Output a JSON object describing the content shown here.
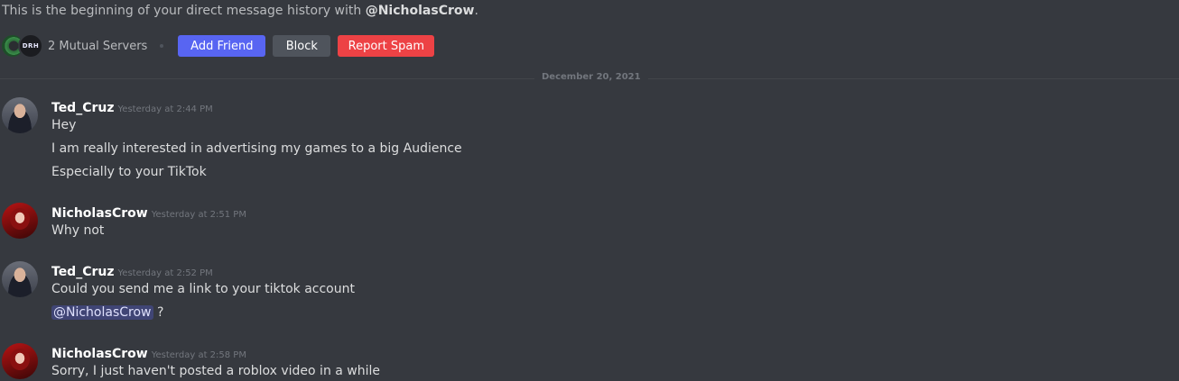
{
  "intro": {
    "prefix": "This is the beginning of your direct message history with ",
    "name": "@NicholasCrow",
    "suffix": "."
  },
  "mutual": {
    "server_icon_2_text": "DRH",
    "label": "2 Mutual Servers"
  },
  "buttons": {
    "add_friend": "Add Friend",
    "block": "Block",
    "report_spam": "Report Spam"
  },
  "divider": {
    "date": "December 20, 2021"
  },
  "messages": [
    {
      "author": "Ted_Cruz",
      "timestamp": "Yesterday at 2:44 PM",
      "lines": [
        "Hey",
        "I am really interested in advertising my games to a big Audience",
        "Especially to your TikTok"
      ]
    },
    {
      "author": "NicholasCrow",
      "timestamp": "Yesterday at 2:51 PM",
      "lines": [
        "Why not"
      ]
    },
    {
      "author": "Ted_Cruz",
      "timestamp": "Yesterday at 2:52 PM",
      "lines": [
        "Could you send me a link to your tiktok account"
      ],
      "mention_line": {
        "mention": "@NicholasCrow",
        "after": " ?"
      }
    },
    {
      "author": "NicholasCrow",
      "timestamp": "Yesterday at 2:58 PM",
      "lines": [
        "Sorry, I just haven't posted a roblox video in a while"
      ]
    }
  ],
  "colors": {
    "background": "#36393f",
    "blurple": "#5865f2",
    "grey_button": "#4f545c",
    "red": "#ed4245"
  }
}
